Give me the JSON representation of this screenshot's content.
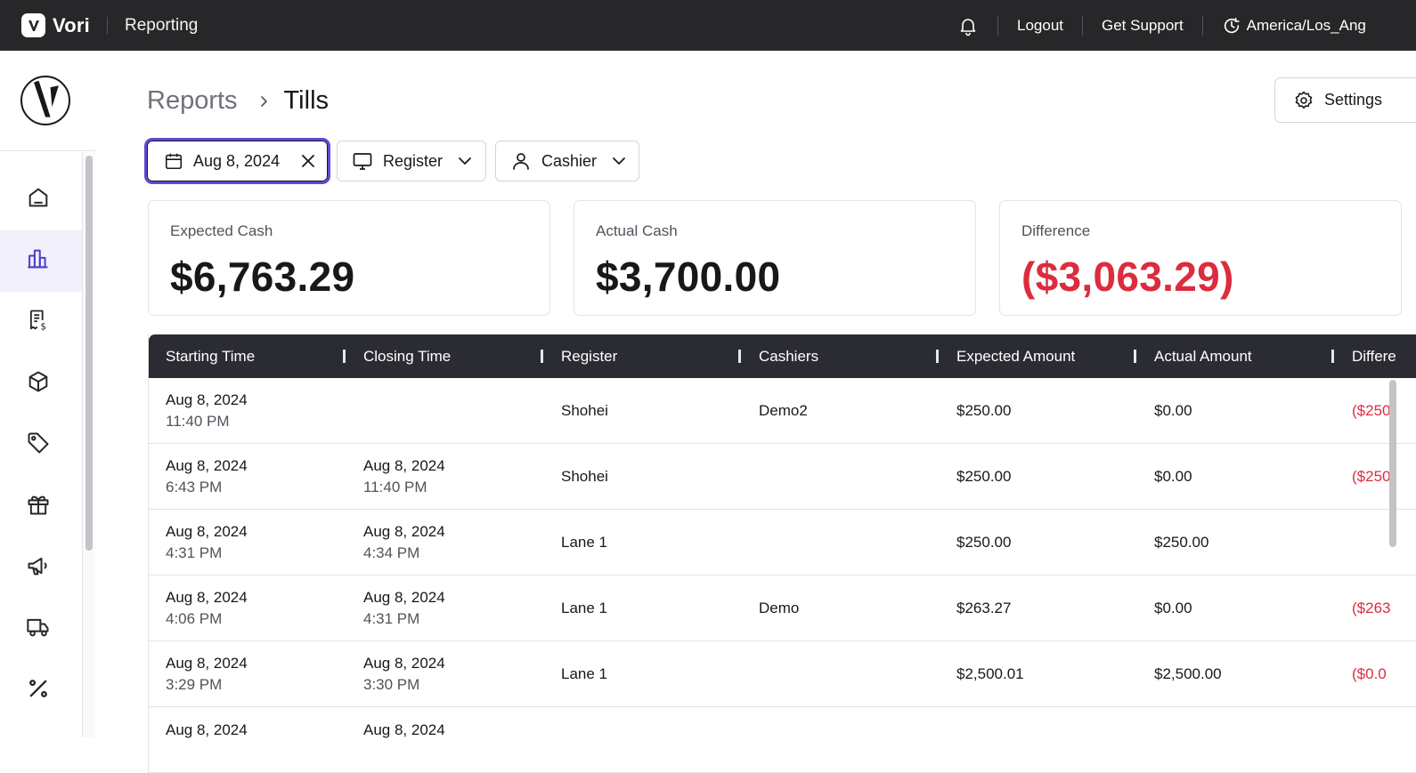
{
  "topbar": {
    "brand": "Vori",
    "app_name": "Reporting",
    "logout": "Logout",
    "support": "Get Support",
    "timezone": "America/Los_Ang"
  },
  "sidebar": {
    "items": [
      {
        "icon": "home-icon",
        "active": false
      },
      {
        "icon": "bar-chart-icon",
        "active": true
      },
      {
        "icon": "receipt-dollar-icon",
        "active": false
      },
      {
        "icon": "box-icon",
        "active": false
      },
      {
        "icon": "tag-icon",
        "active": false
      },
      {
        "icon": "gift-icon",
        "active": false
      },
      {
        "icon": "megaphone-icon",
        "active": false
      },
      {
        "icon": "truck-icon",
        "active": false
      },
      {
        "icon": "percent-icon",
        "active": false
      }
    ]
  },
  "page": {
    "breadcrumb_parent": "Reports",
    "breadcrumb_current": "Tills",
    "settings_label": "Settings"
  },
  "filters": {
    "date": "Aug 8, 2024",
    "register": "Register",
    "cashier": "Cashier"
  },
  "cards": {
    "expected_label": "Expected Cash",
    "expected_value": "$6,763.29",
    "actual_label": "Actual Cash",
    "actual_value": "$3,700.00",
    "difference_label": "Difference",
    "difference_value": "($3,063.29)"
  },
  "table": {
    "columns": [
      "Starting Time",
      "Closing Time",
      "Register",
      "Cashiers",
      "Expected Amount",
      "Actual Amount",
      "Differe"
    ],
    "rows": [
      {
        "start_date": "Aug 8, 2024",
        "start_time": "11:40 PM",
        "close_date": "",
        "close_time": "",
        "register": "Shohei",
        "cashiers": "Demo2",
        "expected": "$250.00",
        "actual": "$0.00",
        "difference": "($250"
      },
      {
        "start_date": "Aug 8, 2024",
        "start_time": "6:43 PM",
        "close_date": "Aug 8, 2024",
        "close_time": "11:40 PM",
        "register": "Shohei",
        "cashiers": "",
        "expected": "$250.00",
        "actual": "$0.00",
        "difference": "($250"
      },
      {
        "start_date": "Aug 8, 2024",
        "start_time": "4:31 PM",
        "close_date": "Aug 8, 2024",
        "close_time": "4:34 PM",
        "register": "Lane 1",
        "cashiers": "",
        "expected": "$250.00",
        "actual": "$250.00",
        "difference": ""
      },
      {
        "start_date": "Aug 8, 2024",
        "start_time": "4:06 PM",
        "close_date": "Aug 8, 2024",
        "close_time": "4:31 PM",
        "register": "Lane 1",
        "cashiers": "Demo",
        "expected": "$263.27",
        "actual": "$0.00",
        "difference": "($263"
      },
      {
        "start_date": "Aug 8, 2024",
        "start_time": "3:29 PM",
        "close_date": "Aug 8, 2024",
        "close_time": "3:30 PM",
        "register": "Lane 1",
        "cashiers": "",
        "expected": "$2,500.01",
        "actual": "$2,500.00",
        "difference": "($0.0"
      },
      {
        "start_date": "Aug 8, 2024",
        "start_time": "",
        "close_date": "Aug 8, 2024",
        "close_time": "",
        "register": "",
        "cashiers": "",
        "expected": "",
        "actual": "",
        "difference": ""
      }
    ]
  },
  "colors": {
    "topbar_bg": "#27272a",
    "table_header_bg": "#2b2c33",
    "accent": "#5b4bd5",
    "negative": "#dc2c3e",
    "active_nav_bg": "#f1f0fb"
  }
}
